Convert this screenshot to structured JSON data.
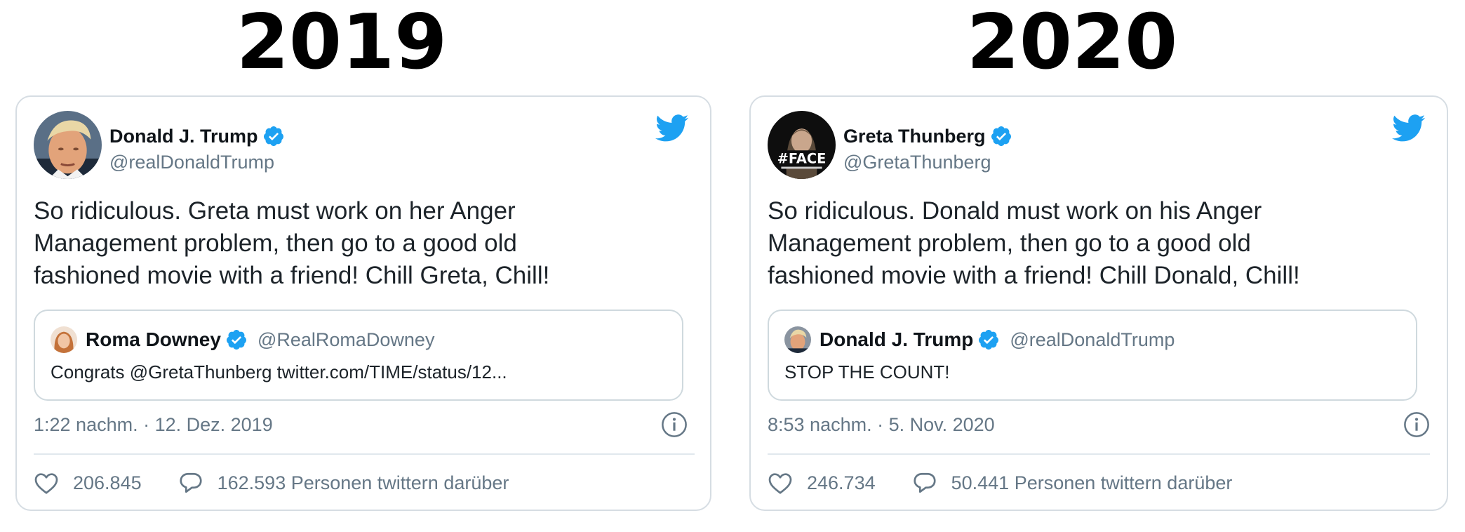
{
  "headings": {
    "left": "2019",
    "right": "2020"
  },
  "tweets": [
    {
      "author": {
        "name": "Donald J. Trump",
        "handle": "@realDonaldTrump",
        "verified": true
      },
      "text_lines": [
        "So ridiculous. Greta must work on her Anger",
        "Management problem, then go to a good old",
        "fashioned movie with a friend! Chill Greta, Chill!"
      ],
      "quote": {
        "name": "Roma Downey",
        "handle": "@RealRomaDowney",
        "verified": true,
        "text": "Congrats @GretaThunberg twitter.com/TIME/status/12..."
      },
      "timestamp": "1:22 nachm. · 12. Dez. 2019",
      "likes": "206.845",
      "talking": "162.593 Personen twittern darüber"
    },
    {
      "author": {
        "name": "Greta Thunberg",
        "handle": "@GretaThunberg",
        "verified": true,
        "avatar_text": "#FACE"
      },
      "text_lines": [
        "So ridiculous. Donald must work on his Anger",
        "Management problem, then go to a good old",
        "fashioned movie with a friend! Chill Donald, Chill!"
      ],
      "quote": {
        "name": "Donald J. Trump",
        "handle": "@realDonaldTrump",
        "verified": true,
        "text": "STOP THE COUNT!"
      },
      "timestamp": "8:53 nachm. · 5. Nov. 2020",
      "likes": "246.734",
      "talking": "50.441 Personen twittern darüber"
    }
  ],
  "colors": {
    "twitter_blue": "#1da1f2",
    "secondary_text": "#657786",
    "border": "#d6dde3"
  },
  "icons": [
    "twitter-bird-icon",
    "verified-badge-icon",
    "info-icon",
    "heart-icon",
    "comment-bubble-icon"
  ]
}
